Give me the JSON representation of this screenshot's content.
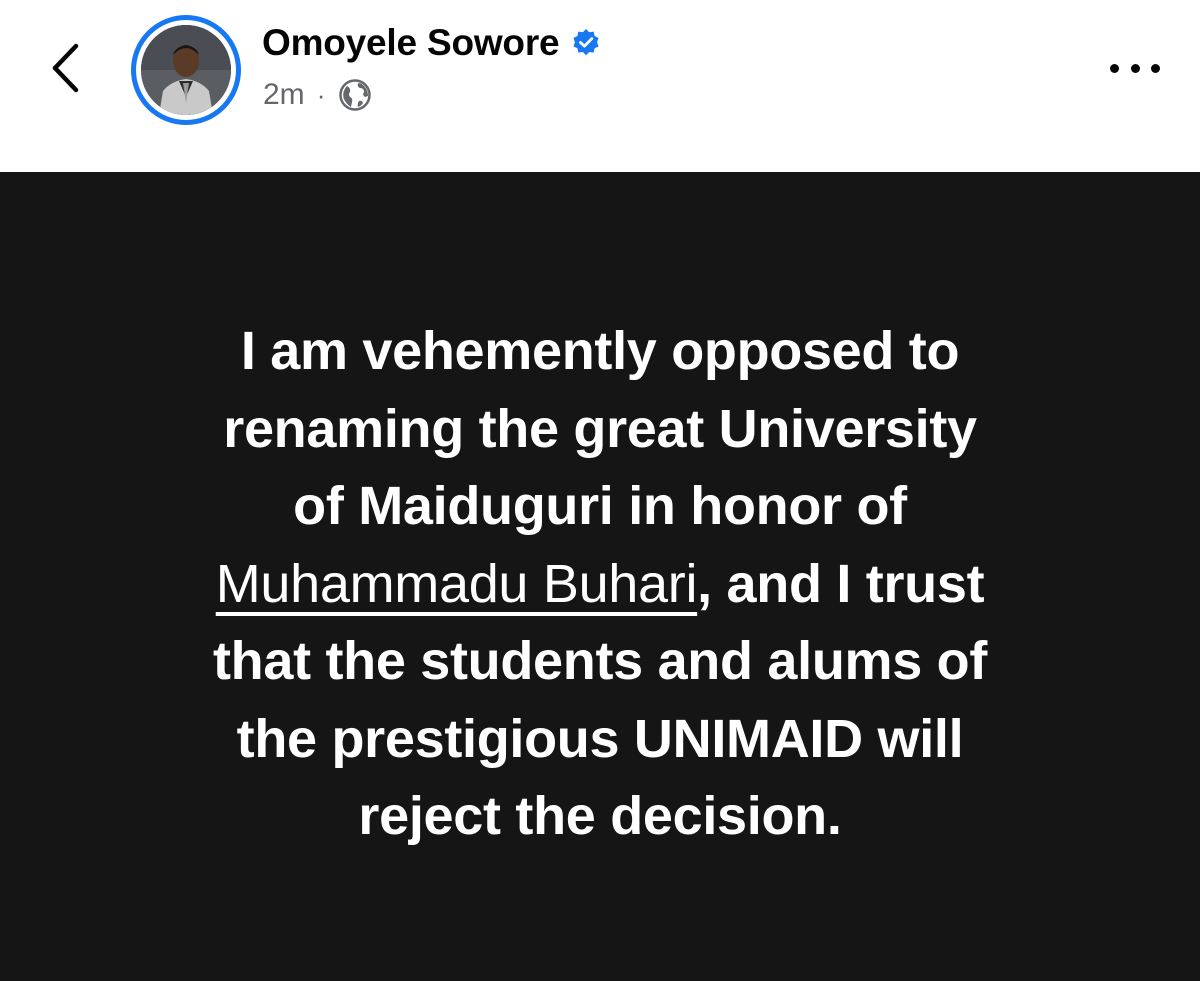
{
  "header": {
    "back_icon": "chevron-left-icon",
    "author_name": "Omoyele Sowore",
    "verified_icon": "verified-badge-icon",
    "post_time": "2m",
    "separator": "·",
    "audience_icon": "globe-icon",
    "more_icon": "more-horizontal-icon"
  },
  "post": {
    "lines": [
      "I am vehemently opposed to",
      "renaming the great University",
      "of Maiduguri in honor of"
    ],
    "mention": "Muhammadu Buhari",
    "mention_tail": ", and I trust",
    "lines_after": [
      "that the students and alums of",
      "the prestigious UNIMAID will",
      "reject the decision."
    ]
  },
  "colors": {
    "accent": "#1877f2",
    "post_background": "#151515",
    "post_text": "#ffffff",
    "meta_text": "#65676b"
  }
}
